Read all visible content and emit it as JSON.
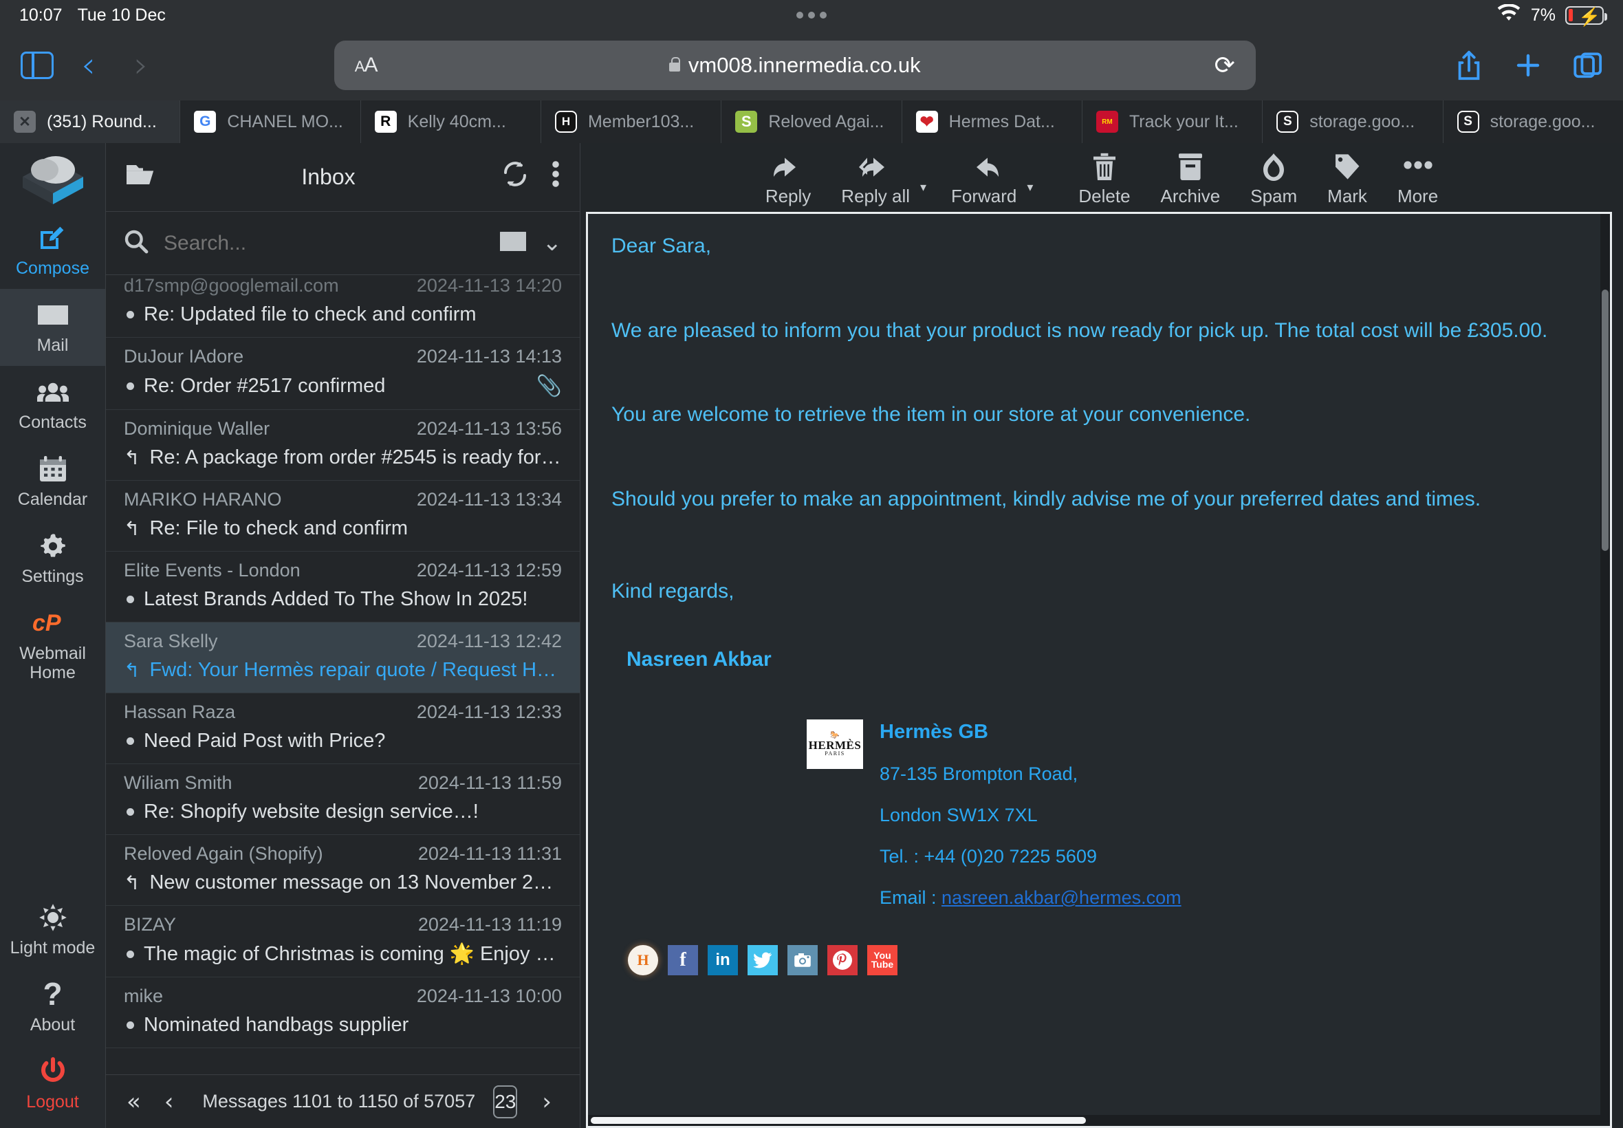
{
  "status_bar": {
    "time": "10:07",
    "date": "Tue 10 Dec",
    "battery_percent": "7%",
    "wifi_icon": "wifi-icon",
    "battery_icon": "battery-charging-icon"
  },
  "browser": {
    "sidebar_icon": "sidebar-toggle-icon",
    "back_icon": "chevron-left-icon",
    "forward_icon": "chevron-right-icon",
    "text_size_label": "AA",
    "lock_icon": "lock-icon",
    "url": "vm008.innermedia.co.uk",
    "reload_icon": "reload-icon",
    "share_icon": "share-icon",
    "new_tab_icon": "plus-icon",
    "tabs_overview_icon": "tabs-icon"
  },
  "tabs": [
    {
      "title": "(351) Round...",
      "favicon": "close-x-icon",
      "active": true
    },
    {
      "title": "CHANEL MO...",
      "favicon": "google-icon",
      "active": false
    },
    {
      "title": "Kelly 40cm...",
      "favicon": "r-letter-icon",
      "active": false
    },
    {
      "title": "Member103...",
      "favicon": "h-letter-icon",
      "active": false
    },
    {
      "title": "Reloved Agai...",
      "favicon": "shopify-icon",
      "active": false
    },
    {
      "title": "Hermes Dat...",
      "favicon": "hermes-icon",
      "active": false
    },
    {
      "title": "Track your It...",
      "favicon": "royal-mail-icon",
      "active": false
    },
    {
      "title": "storage.goo...",
      "favicon": "s-letter-icon",
      "active": false
    },
    {
      "title": "storage.goo...",
      "favicon": "s-letter-icon",
      "active": false
    }
  ],
  "rail": {
    "logo": "roundcube-logo",
    "items": [
      {
        "label": "Compose",
        "icon": "compose-icon",
        "state": "compose"
      },
      {
        "label": "Mail",
        "icon": "envelope-icon",
        "state": "active"
      },
      {
        "label": "Contacts",
        "icon": "contacts-icon",
        "state": ""
      },
      {
        "label": "Calendar",
        "icon": "calendar-icon",
        "state": ""
      },
      {
        "label": "Settings",
        "icon": "gear-icon",
        "state": ""
      },
      {
        "label": "Webmail Home",
        "icon": "cpanel-icon",
        "state": ""
      }
    ],
    "bottom_items": [
      {
        "label": "Light mode",
        "icon": "sun-icon",
        "state": ""
      },
      {
        "label": "About",
        "icon": "question-icon",
        "state": ""
      },
      {
        "label": "Logout",
        "icon": "power-icon",
        "state": "logout"
      }
    ]
  },
  "list_header": {
    "folder_icon": "folder-icon",
    "title": "Inbox",
    "refresh_icon": "refresh-icon",
    "options_icon": "more-vertical-icon"
  },
  "search": {
    "icon": "search-icon",
    "value": "",
    "placeholder": "Search...",
    "scope_icon": "envelope-icon",
    "expand_icon": "chevron-down-icon"
  },
  "messages": [
    {
      "sender": "d17smp@googlemail.com",
      "date": "2024-11-13 14:20",
      "subject": "Re: Updated file to check and confirm",
      "flag": "dot",
      "attachment": false,
      "selected": false,
      "clipped_top": true
    },
    {
      "sender": "DuJour IAdore",
      "date": "2024-11-13 14:13",
      "subject": "Re: Order #2517 confirmed",
      "flag": "dot",
      "attachment": true,
      "selected": false
    },
    {
      "sender": "Dominique Waller",
      "date": "2024-11-13 13:56",
      "subject": "Re: A package from order #2545 is ready for …",
      "flag": "reply",
      "attachment": false,
      "selected": false
    },
    {
      "sender": "MARIKO HARANO",
      "date": "2024-11-13 13:34",
      "subject": "Re: File to check and confirm",
      "flag": "reply",
      "attachment": false,
      "selected": false
    },
    {
      "sender": "Elite Events - London",
      "date": "2024-11-13 12:59",
      "subject": "Latest Brands Added To The Show In 2025!",
      "flag": "dot",
      "attachment": false,
      "selected": false
    },
    {
      "sender": "Sara Skelly",
      "date": "2024-11-13 12:42",
      "subject": "Fwd: Your Hermès repair quote / Request HC…",
      "flag": "reply",
      "attachment": false,
      "selected": true
    },
    {
      "sender": "Hassan Raza",
      "date": "2024-11-13 12:33",
      "subject": "Need Paid Post with Price?",
      "flag": "dot",
      "attachment": false,
      "selected": false
    },
    {
      "sender": "Wiliam Smith",
      "date": "2024-11-13 11:59",
      "subject": "Re: Shopify website design service…!",
      "flag": "dot",
      "attachment": false,
      "selected": false
    },
    {
      "sender": "Reloved Again (Shopify)",
      "date": "2024-11-13 11:31",
      "subject": "New customer message on 13 November 20…",
      "flag": "reply",
      "attachment": false,
      "selected": false
    },
    {
      "sender": "BIZAY",
      "date": "2024-11-13 11:19",
      "subject": "The magic of Christmas is coming 🌟 Enjoy …",
      "flag": "dot",
      "attachment": false,
      "selected": false
    },
    {
      "sender": "mike",
      "date": "2024-11-13 10:00",
      "subject": "Nominated handbags supplier",
      "flag": "dot",
      "attachment": false,
      "selected": false
    }
  ],
  "pager": {
    "first_icon": "double-chevron-left-icon",
    "prev_icon": "chevron-left-icon",
    "status": "Messages 1101 to 1150 of 57057",
    "page_value": "23",
    "next_icon": "chevron-right-icon",
    "last_icon": "double-chevron-right-icon"
  },
  "toolbar": [
    {
      "label": "Reply",
      "icon": "reply-icon",
      "caret": false
    },
    {
      "label": "Reply all",
      "icon": "reply-all-icon",
      "caret": true
    },
    {
      "label": "Forward",
      "icon": "forward-icon",
      "caret": true
    },
    {
      "label": "Delete",
      "icon": "trash-icon",
      "caret": false
    },
    {
      "label": "Archive",
      "icon": "archive-icon",
      "caret": false
    },
    {
      "label": "Spam",
      "icon": "flame-icon",
      "caret": false
    },
    {
      "label": "Mark",
      "icon": "tag-icon",
      "caret": false
    },
    {
      "label": "More",
      "icon": "more-horizontal-icon",
      "caret": false
    }
  ],
  "message_body": {
    "greeting": "Dear Sara,",
    "paragraph_1": "We are pleased to inform you that your product is now ready for pick up. The total cost will be £305.00.",
    "paragraph_2": "You are welcome to retrieve the item in our store at your convenience.",
    "paragraph_3": "Should you prefer to make an appointment, kindly advise me of your preferred dates and times.",
    "signoff": "Kind regards,",
    "sender_name": "Nasreen Akbar"
  },
  "signature": {
    "logo_top": "☲",
    "logo_main": "HERMÈS",
    "logo_sub": "PARIS",
    "company": "Hermès GB",
    "address_line_1": "87-135 Brompton Road,",
    "address_line_2": "London SW1X 7XL",
    "telephone": "Tel. : +44 (0)20 7225 5609",
    "email_label": "Email : ",
    "email": "nasreen.akbar@hermes.com",
    "socials": [
      {
        "name": "hermes-badge-icon",
        "glyph": "H",
        "cls": "round"
      },
      {
        "name": "facebook-icon",
        "glyph": "f",
        "cls": "fb"
      },
      {
        "name": "linkedin-icon",
        "glyph": "in",
        "cls": "li"
      },
      {
        "name": "twitter-icon",
        "glyph": "✉",
        "cls": "tw"
      },
      {
        "name": "instagram-icon",
        "glyph": "◉",
        "cls": "ig"
      },
      {
        "name": "pinterest-icon",
        "glyph": "Ⓟ",
        "cls": "pi"
      },
      {
        "name": "youtube-icon",
        "glyph": "You Tube",
        "cls": "yt"
      }
    ]
  },
  "colors": {
    "accent_blue": "#35a9f5",
    "link_blue": "#1f6fd6",
    "logout_red": "#f1453d",
    "app_bg": "#222629",
    "panel_bg": "#232629",
    "selected_row": "#38434b"
  }
}
